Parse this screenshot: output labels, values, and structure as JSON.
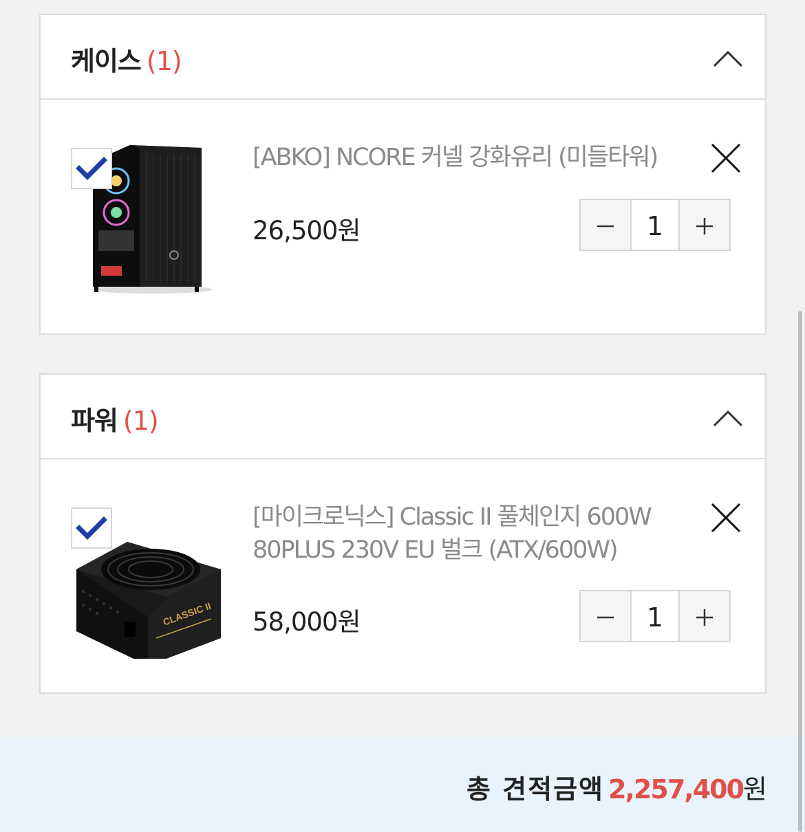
{
  "sections": [
    {
      "title": "케이스",
      "count": "(1)",
      "item": {
        "name": "[ABKO] NCORE 커넬 강화유리 (미들타워)",
        "price": "26,500원",
        "quantity": "1",
        "checked": true
      }
    },
    {
      "title": "파워",
      "count": "(1)",
      "item": {
        "name": "[마이크로닉스] Classic II 풀체인지 600W 80PLUS 230V EU 벌크 (ATX/600W)",
        "price": "58,000원",
        "quantity": "1",
        "checked": true
      }
    }
  ],
  "footer": {
    "total_label": "총 견적금액",
    "total_amount": "2,257,400",
    "total_unit": "원"
  },
  "icons": {
    "collapse": "chevron-up-icon",
    "delete": "close-icon",
    "check": "checkmark-icon",
    "minus": "minus-icon",
    "plus": "plus-icon"
  },
  "colors": {
    "accent_red": "#e0504a",
    "check_blue": "#1f3fa8",
    "footer_bg": "#eaf3fc"
  }
}
